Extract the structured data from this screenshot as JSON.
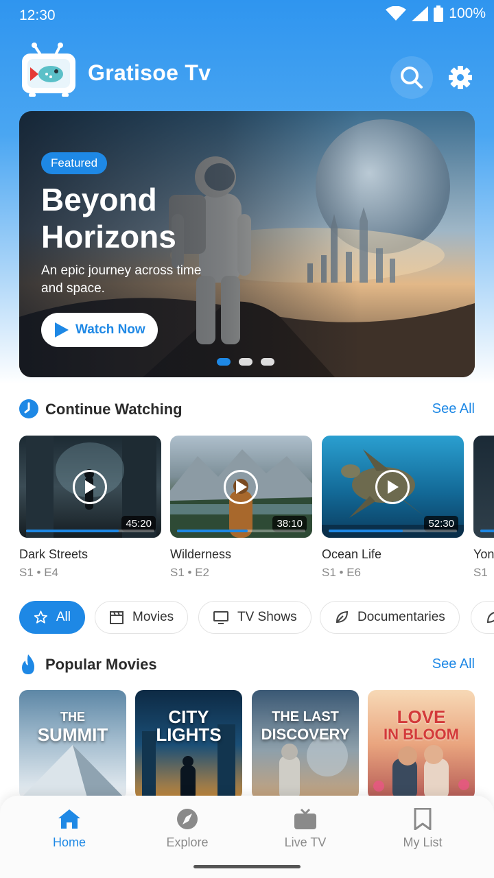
{
  "status_bar": {
    "time": "12:30",
    "battery": "100%"
  },
  "header": {
    "app_name": "Gratisoe Tv"
  },
  "hero": {
    "badge": "Featured",
    "title": "Beyond Horizons",
    "description": "An epic journey across time and space.",
    "cta_label": "Watch Now",
    "active_slide": 1,
    "slide_count": 3
  },
  "continue_watching": {
    "title": "Continue Watching",
    "see_all": "See All",
    "items": [
      {
        "title": "Dark Streets",
        "episode": "S1 • E4",
        "duration": "45:20",
        "progress": 0.72
      },
      {
        "title": "Wilderness",
        "episode": "S1 • E2",
        "duration": "38:10",
        "progress": 0.55
      },
      {
        "title": "Ocean Life",
        "episode": "S1 • E6",
        "duration": "52:30",
        "progress": 0.58
      },
      {
        "title": "Yon",
        "episode": "S1",
        "duration": "",
        "progress": 0.4
      }
    ]
  },
  "categories": {
    "selected": "All",
    "items": [
      {
        "label": "All",
        "icon": "star-icon"
      },
      {
        "label": "Movies",
        "icon": "clapperboard-icon"
      },
      {
        "label": "TV Shows",
        "icon": "tv-icon"
      },
      {
        "label": "Documentaries",
        "icon": "leaf-icon"
      },
      {
        "label": "",
        "icon": "leaf-icon"
      }
    ]
  },
  "popular_movies": {
    "title": "Popular Movies",
    "see_all": "See All",
    "items": [
      {
        "line1": "THE",
        "line2": "SUMMIT"
      },
      {
        "line1": "CITY",
        "line2": "LIGHTS"
      },
      {
        "line1": "THE LAST",
        "line2": "DISCOVERY"
      },
      {
        "line1": "LOVE",
        "line2": "IN BLOOM"
      }
    ]
  },
  "bottom_nav": {
    "active": "Home",
    "items": [
      {
        "label": "Home",
        "icon": "home-icon"
      },
      {
        "label": "Explore",
        "icon": "compass-icon"
      },
      {
        "label": "Live TV",
        "icon": "tv-icon"
      },
      {
        "label": "My List",
        "icon": "bookmark-icon"
      }
    ]
  },
  "colors": {
    "accent": "#1e88e5",
    "header_gradient_top": "#2f95ef"
  }
}
